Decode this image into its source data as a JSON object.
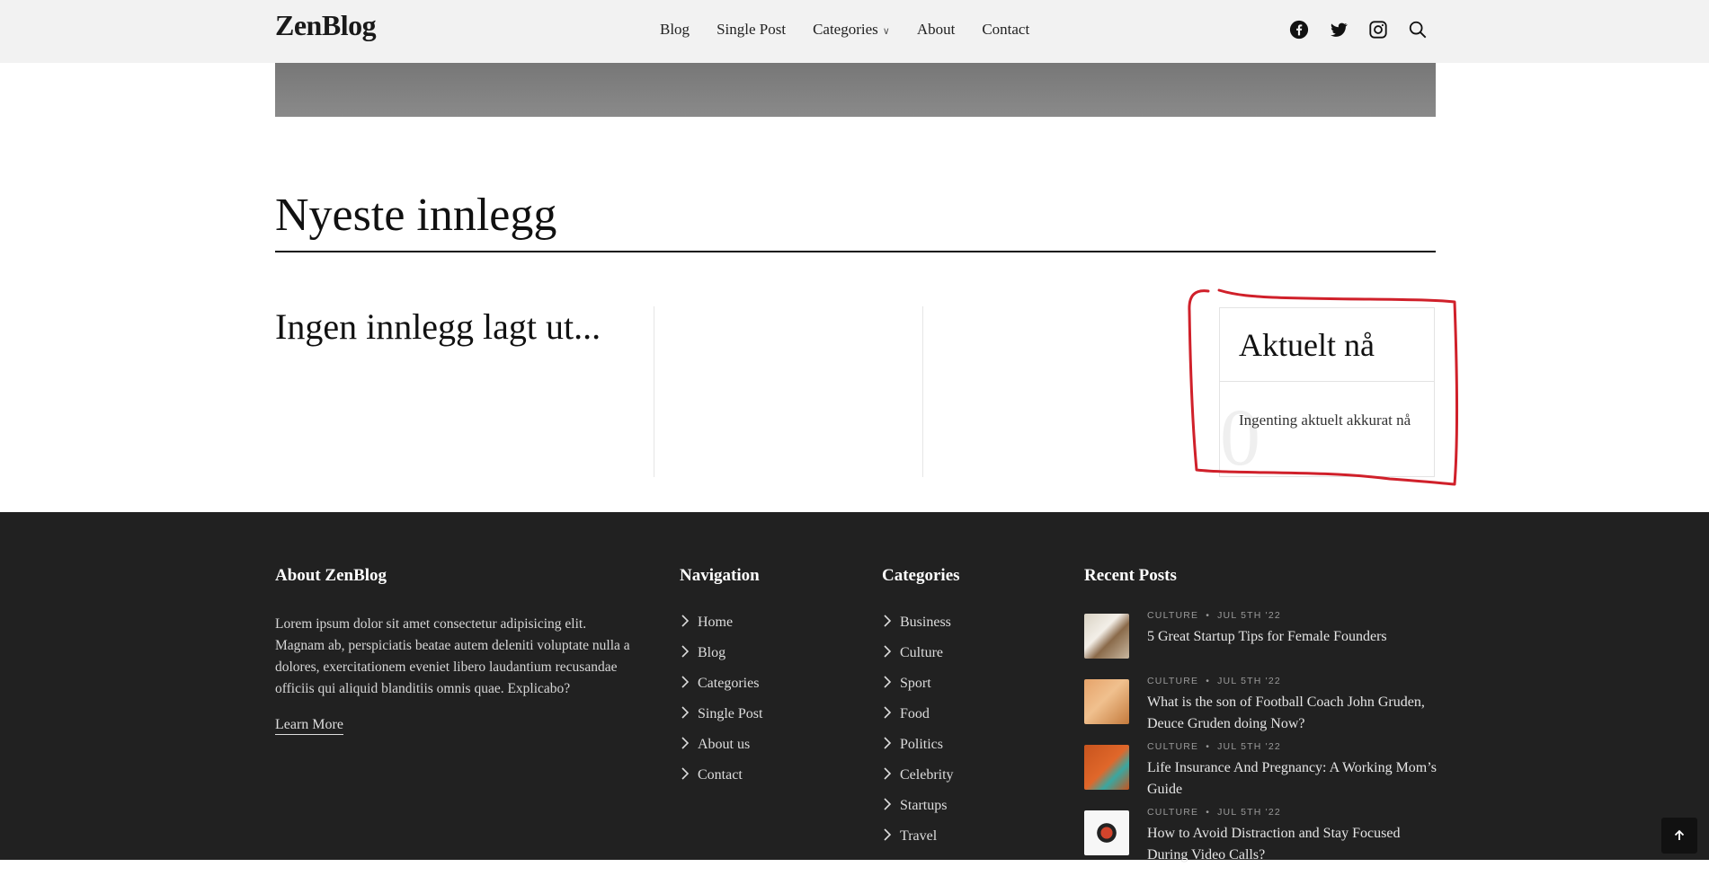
{
  "header": {
    "logo": "ZenBlog",
    "nav": [
      {
        "label": "Blog"
      },
      {
        "label": "Single Post"
      },
      {
        "label": "Categories"
      },
      {
        "label": "About"
      },
      {
        "label": "Contact"
      }
    ],
    "icons": [
      "facebook-icon",
      "twitter-icon",
      "instagram-icon",
      "search-icon"
    ]
  },
  "main": {
    "section_title": "Nyeste innlegg",
    "no_posts": "Ingen innlegg lagt ut...",
    "trending": {
      "title": "Aktuelt nå",
      "number": "0",
      "empty_text": "Ingenting aktuelt akkurat nå"
    }
  },
  "footer": {
    "about": {
      "title": "About ZenBlog",
      "text": "Lorem ipsum dolor sit amet consectetur adipisicing elit. Magnam ab, perspiciatis beatae autem deleniti voluptate nulla a dolores, exercitationem eveniet libero laudantium recusandae officiis qui aliquid blanditiis omnis quae. Explicabo?",
      "link": "Learn More"
    },
    "navigation": {
      "title": "Navigation",
      "items": [
        "Home",
        "Blog",
        "Categories",
        "Single Post",
        "About us",
        "Contact"
      ]
    },
    "categories": {
      "title": "Categories",
      "items": [
        "Business",
        "Culture",
        "Sport",
        "Food",
        "Politics",
        "Celebrity",
        "Startups",
        "Travel"
      ]
    },
    "recent": {
      "title": "Recent Posts",
      "posts": [
        {
          "category": "CULTURE",
          "date": "JUL 5TH '22",
          "title": "5 Great Startup Tips for Female Founders"
        },
        {
          "category": "CULTURE",
          "date": "JUL 5TH '22",
          "title": "What is the son of Football Coach John Gruden, Deuce Gruden doing Now?"
        },
        {
          "category": "CULTURE",
          "date": "JUL 5TH '22",
          "title": "Life Insurance And Pregnancy: A Working Mom’s Guide"
        },
        {
          "category": "CULTURE",
          "date": "JUL 5TH '22",
          "title": "How to Avoid Distraction and Stay Focused During Video Calls?"
        }
      ]
    }
  },
  "colors": {
    "header_bg": "#f2f2f2",
    "footer_bg": "#212121",
    "annotation": "#d0202a"
  }
}
